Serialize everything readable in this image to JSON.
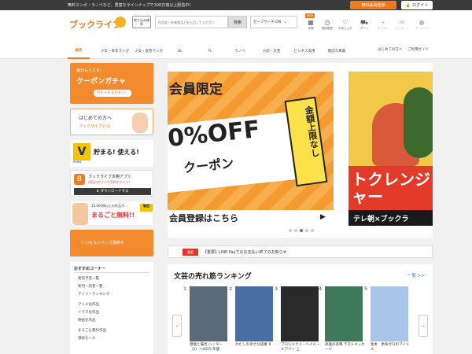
{
  "topbar": {
    "promo": "無料マンガ・ラノベなど、豊富なラインナップで100万冊以上配信中！",
    "register_label": "無料会員登録",
    "login_label": "ログイン"
  },
  "header": {
    "logo": "ブックライブ",
    "detail_search": "絞り込み検索",
    "search_placeholder": "作品名・作者名などを入力してください",
    "search_button": "検索",
    "safe_search": "セーフサーチ:ON",
    "icons": [
      {
        "label": "本棚",
        "icon": "bookshelf-icon",
        "glyph": "▦"
      },
      {
        "label": "閲覧履歴",
        "icon": "history-icon",
        "glyph": "◷"
      },
      {
        "label": "お気に入り",
        "icon": "favorite-icon",
        "glyph": "♡"
      },
      {
        "label": "カート",
        "icon": "cart-icon",
        "glyph": "⛟"
      },
      {
        "label": "クーポン",
        "icon": "coupon-icon",
        "glyph": "+"
      },
      {
        "label": "メッセージ",
        "icon": "message-icon",
        "glyph": "✉"
      },
      {
        "label": "マイページ",
        "icon": "user-icon",
        "glyph": "●"
      }
    ],
    "new_badge": "NEW"
  },
  "nav": {
    "tabs": [
      "総合",
      "少年・青年マンガ",
      "少女・女性マンガ",
      "BL",
      "TL",
      "ラノベ",
      "小説・文芸",
      "ビジネス実用",
      "雑誌写真集"
    ],
    "first_time": "はじめての方へ",
    "guide": "ご利用ガイド"
  },
  "sidebar": {
    "gacha_top": "毎日もらえる！",
    "gacha_title": "クーポンガチャ",
    "gacha_button": "ガチャをまわそう！",
    "first_title": "はじめての方へ",
    "first_sub": "ブックライブとは",
    "tpoint_logo": "V",
    "tpoint_sub": "POINT",
    "tpoint_text": "貯まる! 使える!",
    "app_title": "ブックライブ本棚アプリ",
    "app_sub": "初回ログインで100ポイント!",
    "app_download": "ダウンロードする",
    "free_top": "10,000冊以上の作品が…",
    "free_title": "まるごと無料!!",
    "free_zero": "¥0",
    "ad_text": "いつもらにマンガ最新を",
    "rec_title": "おすすめコーナー",
    "rec_items": [
      "発売予定一覧",
      "新刊・続巻一覧",
      "デイリーランキング",
      "アニメ化作品",
      "ドラマ化作品",
      "映画化作品",
      "まるごと無料作品",
      "激安セール"
    ]
  },
  "carousel": {
    "slide1_title": "会員限定",
    "slide1_big": "0%OFF",
    "slide1_coupon": "クーポン",
    "slide1_tag": "金額上限なし",
    "slide1_footer": "会員登録はこちら",
    "slide2_title": "トクレンジャー",
    "slide2_footer": "テレ朝×ブックラ",
    "dots": 5,
    "active_dot": 3
  },
  "notice": {
    "badge": "重要",
    "text": "【重要】LINE Payでのお支払い終了のお知らせ"
  },
  "ranking": {
    "title": "文芸の売れ筋ランキング",
    "more": "一覧 >>",
    "books": [
      {
        "rank": "1",
        "title": "傲慢と偏見 ハンター（1）〜2025 年版",
        "color": "#5a6a7a"
      },
      {
        "rank": "2",
        "title": "わたしの幸せな結婚 ８",
        "color": "#4a6fa5"
      },
      {
        "rank": "3",
        "title": "プロジェクト・ヘイル・メアリー 上",
        "color": "#2a2a2a"
      },
      {
        "rank": "4",
        "title": "英雄の悲鳴 ラストメッセージ",
        "color": "#3e7a5a"
      },
      {
        "rank": "5",
        "title": "金本　余命ゼロのアイドル",
        "color": "#a8c7e8"
      }
    ]
  }
}
